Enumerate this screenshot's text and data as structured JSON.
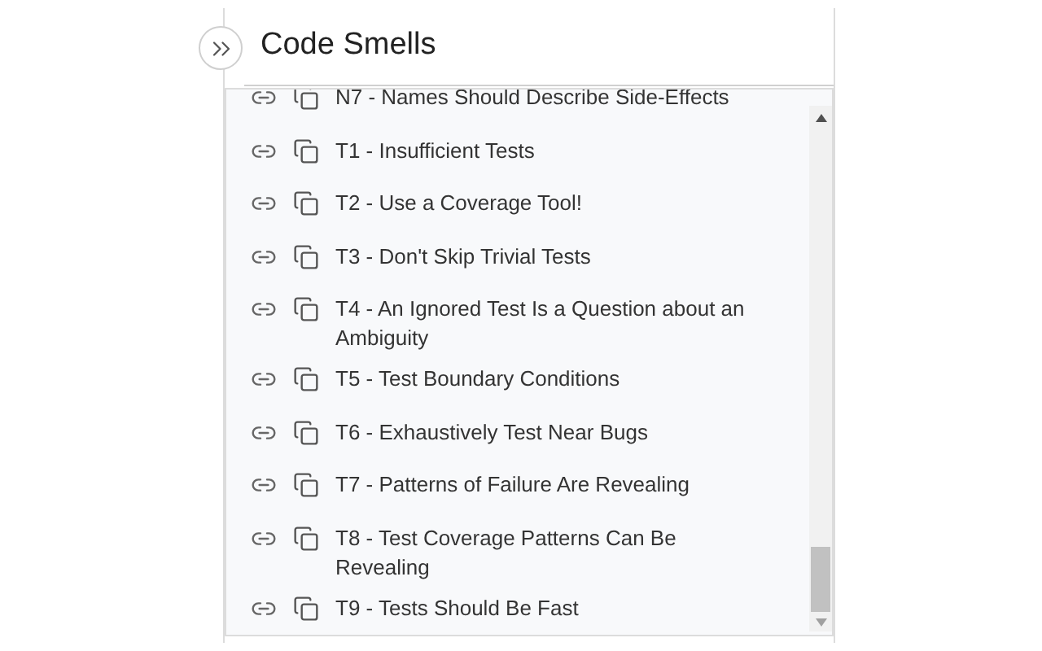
{
  "panel": {
    "title": "Code Smells"
  },
  "items": [
    {
      "label": "N7 - Names Should Describe Side-Effects"
    },
    {
      "label": "T1 - Insufficient Tests"
    },
    {
      "label": "T2 - Use a Coverage Tool!"
    },
    {
      "label": "T3 - Don't Skip Trivial Tests"
    },
    {
      "label": "T4 - An Ignored Test Is a Question about an Ambiguity"
    },
    {
      "label": "T5 - Test Boundary Conditions"
    },
    {
      "label": "T6 - Exhaustively Test Near Bugs"
    },
    {
      "label": "T7 - Patterns of Failure Are Revealing"
    },
    {
      "label": "T8 - Test Coverage Patterns Can Be Revealing"
    },
    {
      "label": "T9 - Tests Should Be Fast"
    }
  ]
}
